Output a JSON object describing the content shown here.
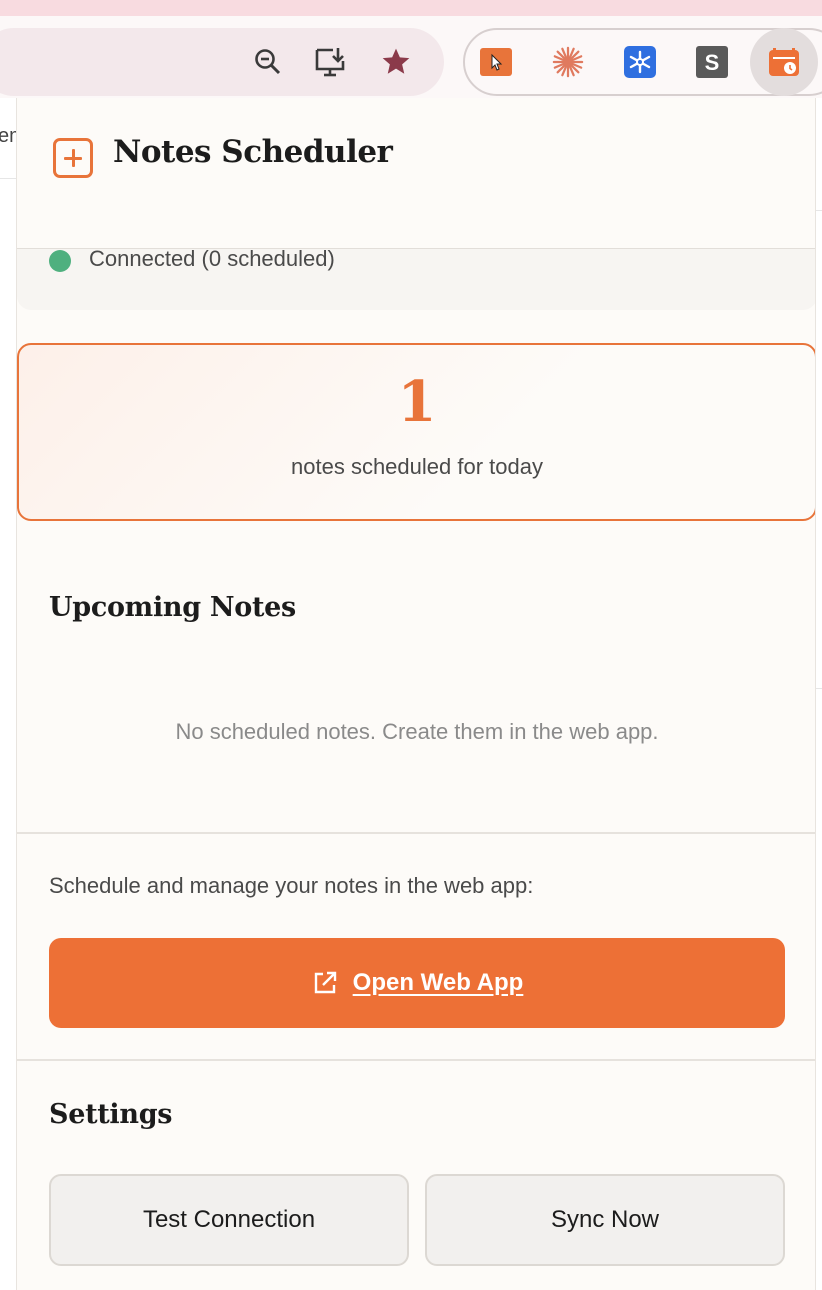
{
  "browser": {
    "icons": [
      "zoom-out-icon",
      "install-app-icon",
      "bookmark-star-icon"
    ],
    "extensions": [
      "cursor-extension-icon",
      "claude-extension-icon",
      "snowflake-extension-icon",
      "s-extension-icon",
      "notes-scheduler-extension-icon"
    ]
  },
  "header": {
    "title": "Notes Scheduler"
  },
  "status": {
    "text": "Connected (0 scheduled)",
    "color": "#4fb07f"
  },
  "today": {
    "count": "1",
    "label": "notes scheduled for today"
  },
  "upcoming": {
    "title": "Upcoming Notes",
    "empty_message": "No scheduled notes. Create them in the web app."
  },
  "webapp": {
    "description": "Schedule and manage your notes in the web app:",
    "button_label": "Open Web App"
  },
  "settings": {
    "title": "Settings",
    "test_button": "Test Connection",
    "sync_button": "Sync Now"
  },
  "colors": {
    "accent": "#ed7036",
    "success": "#4fb07f",
    "background": "#fdfbf8"
  },
  "background_page": {
    "fragments": [
      "em"
    ]
  }
}
